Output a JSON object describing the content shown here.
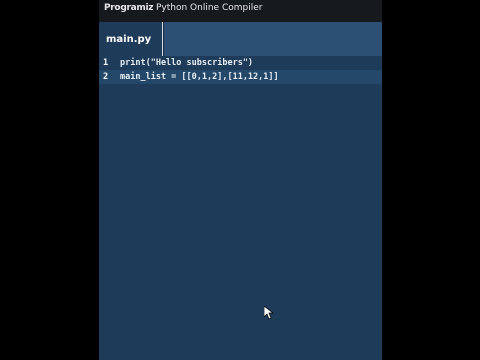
{
  "header": {
    "logo_text": "Programiz",
    "title": "Python Online Compiler"
  },
  "tabs": [
    {
      "label": "main.py"
    }
  ],
  "editor": {
    "lines": [
      {
        "number": "1",
        "code": "print(\"Hello subscribers\")"
      },
      {
        "number": "2",
        "code": "main_list = [[0,1,2],[11,12,1]]"
      }
    ]
  },
  "colors": {
    "editor_background": "#1e3b59",
    "header_background": "#16191e",
    "number_literal": "#f2a0a0"
  },
  "icons": {
    "pointer": "mouse-pointer-icon"
  }
}
